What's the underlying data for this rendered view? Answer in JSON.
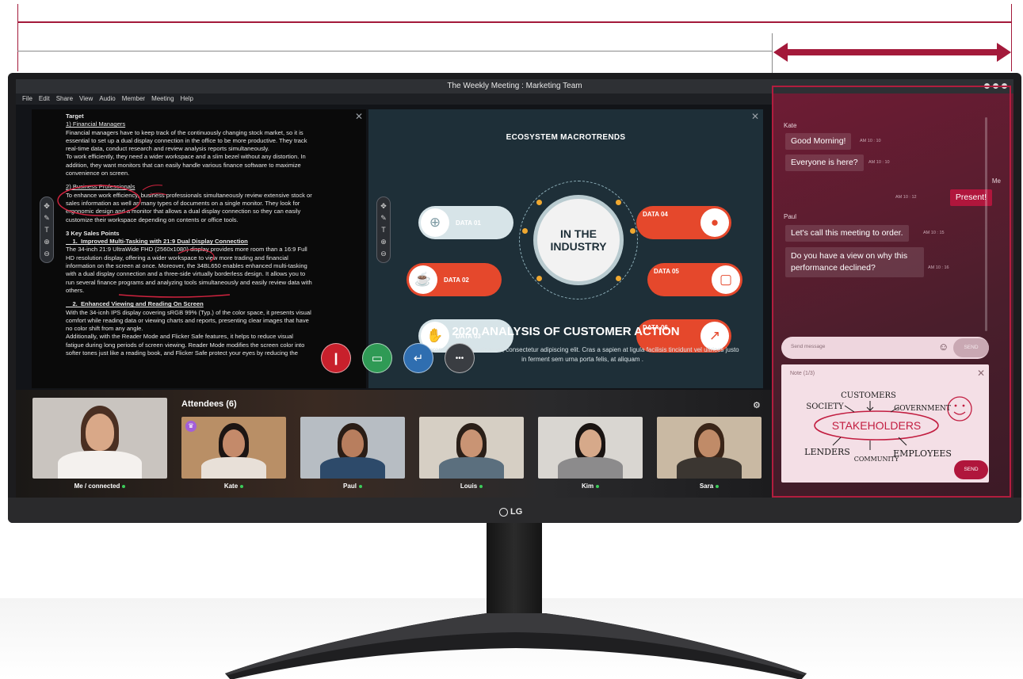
{
  "window": {
    "title": "The Weekly Meeting : Marketing Team"
  },
  "menu": [
    "File",
    "Edit",
    "Share",
    "View",
    "Audio",
    "Member",
    "Meeting",
    "Help"
  ],
  "document": {
    "lines": [
      {
        "text": "Target",
        "style": "b"
      },
      {
        "text": "1) Financial Managers",
        "style": "u"
      },
      {
        "text": "Financial managers have to keep track of the continuously changing stock market, so it is",
        "style": ""
      },
      {
        "text": "essential to set up a dual display connection in the office to be more productive. They track",
        "style": ""
      },
      {
        "text": "real-time data, conduct research and review analysis reports simultaneously.",
        "style": ""
      },
      {
        "text": "To work efficiently, they need a wider workspace and a slim bezel without any distortion. In",
        "style": ""
      },
      {
        "text": "addition, they want monitors that can easily handle various finance software to maximize",
        "style": ""
      },
      {
        "text": "convenience on screen.",
        "style": ""
      },
      {
        "text": "",
        "style": "gap"
      },
      {
        "text": "2) Business Professionals",
        "style": "u"
      },
      {
        "text": "To enhance work efficiency, business professionals simultaneously review extensive stock or",
        "style": ""
      },
      {
        "text": "sales information as well as many types of documents on a single monitor. They look for",
        "style": ""
      },
      {
        "text": "ergonomic design and a monitor that allows a dual display connection so they can easily",
        "style": ""
      },
      {
        "text": "customize their workspace depending on contents or office tools.",
        "style": ""
      },
      {
        "text": "",
        "style": "gap"
      },
      {
        "text": "3 Key Sales Points",
        "style": "b"
      },
      {
        "text": "    1.  Improved Multi-Tasking with 21:9 Dual Display Connection",
        "style": "bu"
      },
      {
        "text": "The 34-inch 21:9 UltraWide FHD (2560x1080) display provides more room than a 16:9 Full",
        "style": ""
      },
      {
        "text": "HD resolution display, offering a wider workspace to view more trading and financial",
        "style": ""
      },
      {
        "text": "information on the screen at once. Moreover, the 34BL650 enables enhanced multi-tasking",
        "style": ""
      },
      {
        "text": "with a dual display connection and a three-side virtually borderless design. It allows you to",
        "style": ""
      },
      {
        "text": "run several finance programs and analyzing tools simultaneously and easily review data with",
        "style": ""
      },
      {
        "text": "others.",
        "style": ""
      },
      {
        "text": "",
        "style": "gap"
      },
      {
        "text": "    2.  Enhanced Viewing and Reading On Screen",
        "style": "bu"
      },
      {
        "text": "With the 34-icnh IPS display covering sRGB 99% (Typ.) of the color space, it presents visual",
        "style": ""
      },
      {
        "text": "comfort while reading data or viewing charts and reports, presenting clear images that have",
        "style": ""
      },
      {
        "text": "no color shift from any angle.",
        "style": ""
      },
      {
        "text": "Additionally, with the Reader Mode and Flicker Safe features, it helps to reduce visual",
        "style": ""
      },
      {
        "text": "fatigue during long periods of screen viewing. Reader Mode modifies the screen color into",
        "style": ""
      },
      {
        "text": "softer tones just like a reading book, and Flicker Safe protect your eyes by reducing the",
        "style": ""
      }
    ]
  },
  "slide": {
    "title": "ECOSYSTEM MACROTRENDS",
    "center": "IN THE\nINDUSTRY",
    "items": [
      {
        "label": "DATA 01",
        "icon": "⊕",
        "icon_name": "globe-icon",
        "side": "left"
      },
      {
        "label": "DATA 02",
        "icon": "☕",
        "icon_name": "coffee-cup-icon",
        "side": "left"
      },
      {
        "label": "DATA 03",
        "icon": "✋",
        "icon_name": "handshake-icon",
        "side": "left"
      },
      {
        "label": "DATA 04",
        "icon": "●",
        "icon_name": "piggy-bank-icon",
        "side": "right"
      },
      {
        "label": "DATA 05",
        "icon": "▢",
        "icon_name": "megaphone-icon",
        "side": "right"
      },
      {
        "label": "DATA 06",
        "icon": "↗",
        "icon_name": "growth-chart-icon",
        "side": "right"
      }
    ],
    "subtitle": "2020 ANALYSIS OF CUSTOMER ACTION",
    "body": "Lorem ipsum dolor sit amet, consectetur adipiscing elit. Cras a sapien at ligula facilisis tincidunt vel ultrices justo in ferment sem urna porta felis, at aliquam ."
  },
  "controls": [
    {
      "name": "microphone-button",
      "icon": "❙",
      "color": "#c8202c"
    },
    {
      "name": "camera-button",
      "icon": "▭",
      "color": "#2f9a55"
    },
    {
      "name": "share-screen-button",
      "icon": "↵",
      "color": "#2f6eb0"
    },
    {
      "name": "more-options-button",
      "icon": "•••",
      "color": "#3a3d42"
    }
  ],
  "attendees": {
    "title": "Attendees (6)",
    "people": [
      {
        "name": "Me / connected",
        "bg": "#c9c4bf",
        "skin": "#d9a888",
        "hair": "#4a2f22",
        "shirt": "#f4f1ee"
      },
      {
        "name": "Kate",
        "bg": "#b98f66",
        "skin": "#c48a6a",
        "hair": "#1c1513",
        "shirt": "#e8e0d8",
        "host": true
      },
      {
        "name": "Paul",
        "bg": "#b7bdc3",
        "skin": "#b87e5e",
        "hair": "#2a1d16",
        "shirt": "#2d4a6a"
      },
      {
        "name": "Louis",
        "bg": "#d6cfc4",
        "skin": "#c99474",
        "hair": "#2a1f18",
        "shirt": "#5b6f7e"
      },
      {
        "name": "Kim",
        "bg": "#d9d6d1",
        "skin": "#d6a98a",
        "hair": "#1a1412",
        "shirt": "#8c8b8c"
      },
      {
        "name": "Sara",
        "bg": "#c9b9a3",
        "skin": "#c08b68",
        "hair": "#3a2518",
        "shirt": "#3b3631"
      }
    ]
  },
  "chat": {
    "messages": [
      {
        "sender": "Kate",
        "text": "Good Morning!",
        "time": "AM 10 : 10"
      },
      {
        "sender": "",
        "text": "Everyone is here?",
        "time": "AM 10 : 10"
      },
      {
        "sender": "Me",
        "text": "Present!",
        "time": "AM 10 : 12"
      },
      {
        "sender": "Paul",
        "text": "Let's call this meeting to order.",
        "time": "AM 10 : 15"
      },
      {
        "sender": "",
        "text": "Do you have a view on why this performance  declined?",
        "time": "AM 10 : 16"
      }
    ],
    "input_placeholder": "Send message",
    "send_label": "SEND",
    "emoji_icon": "☺"
  },
  "note": {
    "title": "Note (1/3)",
    "send_label": "SEND",
    "sketch": {
      "center": "STAKEHOLDERS",
      "words": [
        "CUSTOMERS",
        "SOCIETY",
        "GOVERNMENT",
        "LENDERS",
        "COMMUNITY",
        "EMPLOYEES"
      ]
    }
  },
  "brand": "LG",
  "colors": {
    "accent": "#b0163c",
    "slide_bg": "#1e2f38",
    "slide_red": "#e5482c",
    "slide_light": "#d7e4e8",
    "chat_bg": "#5a1d2f"
  }
}
